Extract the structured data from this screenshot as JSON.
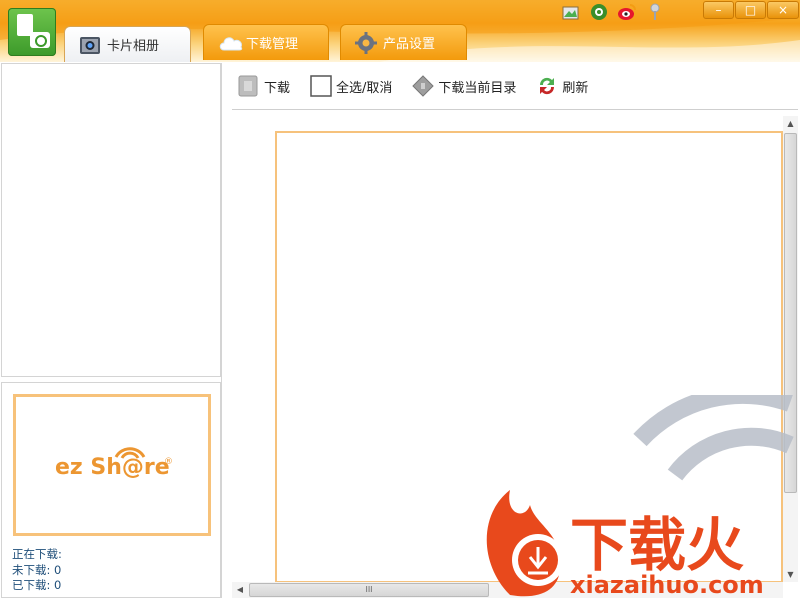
{
  "tabs": [
    {
      "label": "卡片相册",
      "icon": "camera-icon",
      "active": true
    },
    {
      "label": "下载管理",
      "icon": "cloud-icon",
      "active": false
    },
    {
      "label": "产品设置",
      "icon": "gear-icon",
      "active": false
    }
  ],
  "top_icons": [
    "photo-icon",
    "settings-gear-icon",
    "weibo-icon",
    "pin-icon"
  ],
  "window_buttons": {
    "minimize": "–",
    "maximize": "□",
    "close": "×"
  },
  "toolbar": {
    "download": "下载",
    "select_all": "全选/取消",
    "download_current_dir": "下载当前目录",
    "refresh": "刷新"
  },
  "brand": {
    "logo_text": "ez Sh@re",
    "registered": "®"
  },
  "status": {
    "downloading": "正在下载:",
    "not_downloaded": "未下载: 0",
    "downloaded": "已下载: 0"
  },
  "scrollbar": {
    "h_grip": "III"
  },
  "watermark": {
    "title": "下载火",
    "url": "xiazaihuo.com"
  },
  "colors": {
    "accent": "#f6a21a",
    "frame": "#f6c27c",
    "logo": "#ec9631",
    "status_text": "#1f4e79"
  }
}
